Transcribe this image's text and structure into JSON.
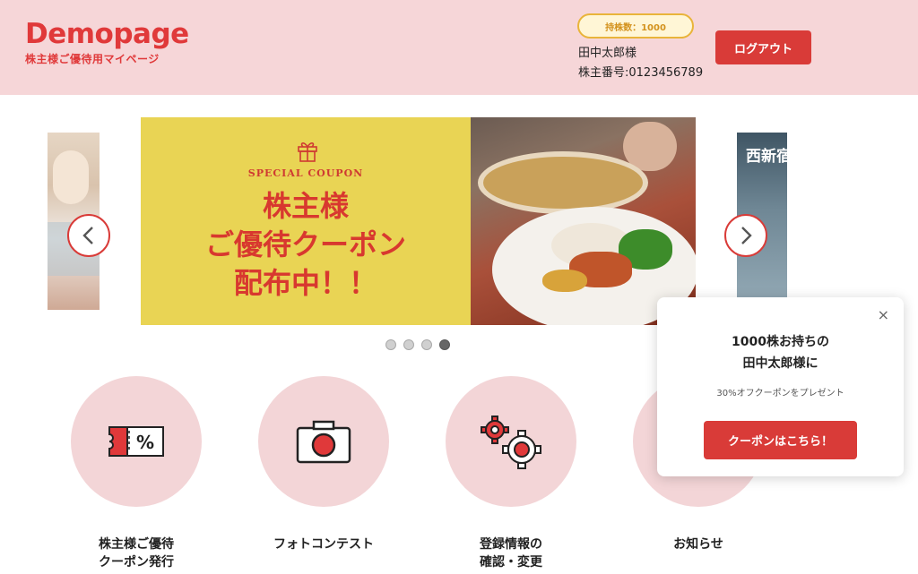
{
  "header": {
    "logo_text": "Demopage",
    "logo_subtitle": "株主様ご優待用マイページ",
    "shares_badge": "持株数：1000",
    "user_name": "田中太郎様",
    "shareholder_number": "株主番号:0123456789",
    "logout_label": "ログアウト"
  },
  "carousel": {
    "main_slide": {
      "eyebrow": "SPECIAL COUPON",
      "heading_line1": "株主様",
      "heading_line2": "ご優待クーポン",
      "heading_line3": "配布中！！",
      "icon": "gift-icon"
    },
    "right_peek_title": "西新宿",
    "prev_icon": "chevron-left-icon",
    "next_icon": "chevron-right-icon",
    "dots_count": 4,
    "active_dot": 4
  },
  "menu": [
    {
      "label": "株主様ご優待\nクーポン発行",
      "icon": "ticket-icon"
    },
    {
      "label": "フォトコンテスト",
      "icon": "camera-icon"
    },
    {
      "label": "登録情報の\n確認・変更",
      "icon": "gears-icon"
    },
    {
      "label": "お知らせ",
      "icon": "bell-icon"
    }
  ],
  "popup": {
    "title": "1000株お持ちの\n田中太郎様に",
    "subtitle": "30%オフクーポンをプレゼント",
    "button_label": "クーポンはこちら！",
    "close_glyph": "×"
  },
  "colors": {
    "accent": "#d93b38",
    "header_bg": "#f6d6d8",
    "badge_border": "#e9b43a",
    "slide_yellow": "#e9d454"
  }
}
